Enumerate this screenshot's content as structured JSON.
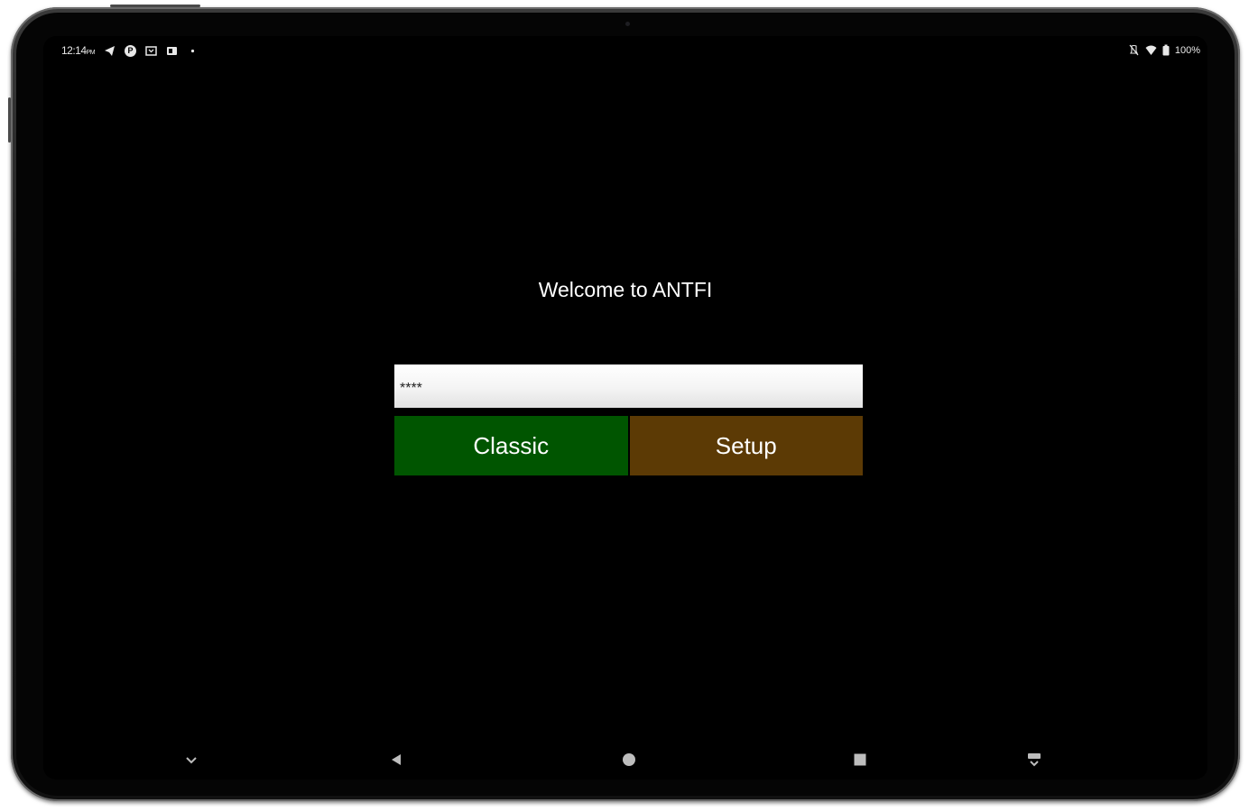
{
  "status_bar": {
    "time": "12:14",
    "ampm": "PM",
    "battery": "100%",
    "left_icons": [
      "telegram-icon",
      "p-app-icon",
      "cast-icon",
      "screenshot-icon",
      "dot-icon"
    ],
    "right_icons": [
      "mute-icon",
      "wifi-icon",
      "battery-icon"
    ]
  },
  "app": {
    "welcome_text": "Welcome to ANTFI",
    "pin_value": "****",
    "classic_label": "Classic",
    "setup_label": "Setup",
    "colors": {
      "classic": "#005500",
      "setup": "#5c3a05",
      "background": "#000000"
    }
  },
  "nav_bar": {
    "items": [
      "collapse-icon",
      "back-icon",
      "home-icon",
      "recents-icon",
      "keyboard-switch-icon"
    ]
  }
}
